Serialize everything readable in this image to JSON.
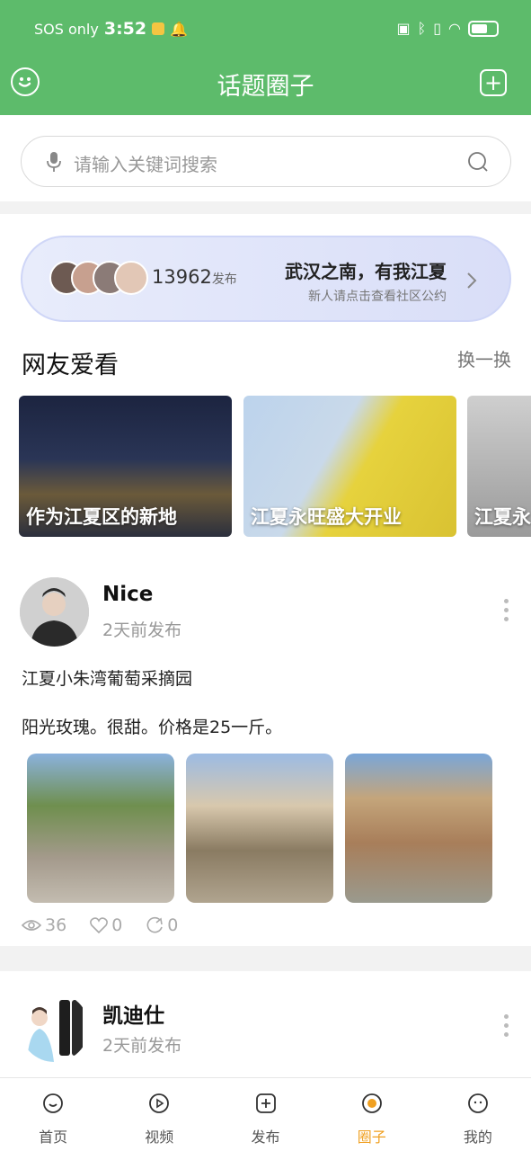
{
  "status_bar": {
    "carrier": "SOS only",
    "time": "3:52"
  },
  "header": {
    "title": "话题圈子"
  },
  "search": {
    "placeholder": "请输入关键词搜索"
  },
  "banner": {
    "count": "13962",
    "count_suffix": "发布",
    "title": "武汉之南，有我江夏",
    "subtitle": "新人请点击查看社区公约"
  },
  "section": {
    "title": "网友爱看",
    "refresh_label": "换一换"
  },
  "tiles": [
    {
      "caption": "作为江夏区的新地"
    },
    {
      "caption": "江夏永旺盛大开业"
    },
    {
      "caption": "江夏永"
    }
  ],
  "post1": {
    "name": "Nice",
    "time": "2天前发布",
    "text_line1": "江夏小朱湾葡萄采摘园",
    "text_line2": "阳光玫瑰。很甜。价格是25一斤。",
    "views": "36",
    "likes": "0",
    "shares": "0"
  },
  "post2": {
    "name": "凯迪仕",
    "time": "2天前发布"
  },
  "tabs": [
    {
      "label": "首页",
      "icon": "home-icon"
    },
    {
      "label": "视频",
      "icon": "video-icon"
    },
    {
      "label": "发布",
      "icon": "publish-icon"
    },
    {
      "label": "圈子",
      "icon": "circle-icon",
      "active": true
    },
    {
      "label": "我的",
      "icon": "profile-icon"
    }
  ],
  "colors": {
    "brand": "#5dbb6b",
    "active_tab": "#f0a021"
  }
}
